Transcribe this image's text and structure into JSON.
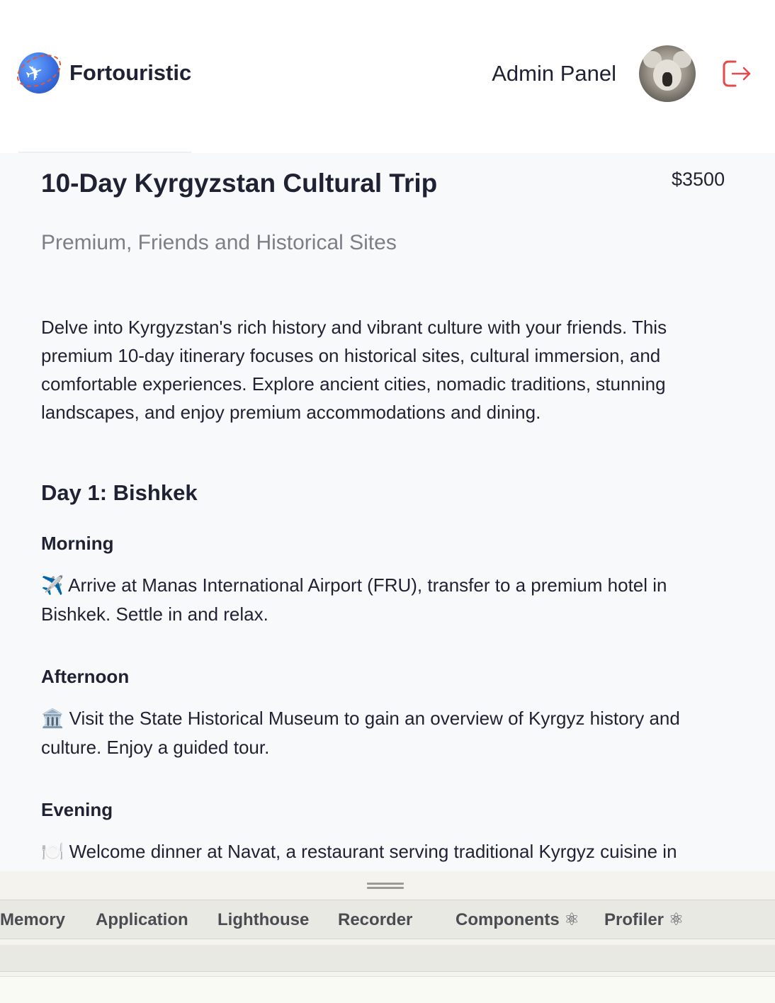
{
  "header": {
    "brand_name": "Fortouristic",
    "admin_link": "Admin Panel"
  },
  "trip": {
    "title": "10-Day Kyrgyzstan Cultural Trip",
    "price": "$3500",
    "tags": "Premium, Friends and Historical Sites",
    "description": "Delve into Kyrgyzstan's rich history and vibrant culture with your friends. This premium 10-day itinerary focuses on historical sites, cultural immersion, and comfortable experiences. Explore ancient cities, nomadic traditions, stunning landscapes, and enjoy premium accommodations and dining."
  },
  "itinerary": {
    "day_title": "Day 1: Bishkek",
    "slots": [
      {
        "label": "Morning",
        "emoji": "✈️",
        "text": "Arrive at Manas International Airport (FRU), transfer to a premium hotel in Bishkek. Settle in and relax."
      },
      {
        "label": "Afternoon",
        "emoji": "🏛️",
        "text": "Visit the State Historical Museum to gain an overview of Kyrgyz history and culture. Enjoy a guided tour."
      },
      {
        "label": "Evening",
        "emoji": "🍽️",
        "text": "Welcome dinner at Navat, a restaurant serving traditional Kyrgyz cuisine in"
      }
    ]
  },
  "devtools": {
    "tabs": [
      "Memory",
      "Application",
      "Lighthouse",
      "Recorder",
      "Components ⚛",
      "Profiler ⚛"
    ]
  },
  "colors": {
    "background": "#f8f9fb",
    "text": "#1f2233",
    "muted": "#7d7f87",
    "logout_accent": "#e5484d"
  },
  "icons": {
    "brand": "globe-plane-icon",
    "logout": "logout-icon",
    "avatar": "koala-avatar"
  }
}
